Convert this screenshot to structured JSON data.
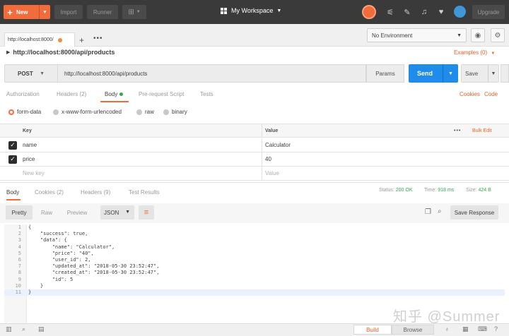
{
  "header": {
    "new_label": "New",
    "import_label": "Import",
    "runner_label": "Runner",
    "workspace_label": "My Workspace",
    "upgrade_label": "Upgrade",
    "icons": [
      "sync-icon",
      "satellite-icon",
      "wrench-icon",
      "bell-icon",
      "heart-icon",
      "avatar"
    ]
  },
  "tabs": [
    {
      "label": "http://localhost:8000/",
      "unsaved": true
    }
  ],
  "environment": {
    "selected": "No Environment"
  },
  "request": {
    "breadcrumb": "http://localhost:8000/api/products",
    "examples_label": "Examples (0)",
    "method": "POST",
    "url": "http://localhost:8000/api/products",
    "params_label": "Params",
    "send_label": "Send",
    "save_label": "Save"
  },
  "request_tabs": {
    "authorization": "Authorization",
    "headers": "Headers (2)",
    "body": "Body",
    "prerequest": "Pre-request Script",
    "tests": "Tests",
    "cookies": "Cookies",
    "code": "Code"
  },
  "body_types": {
    "form_data": "form-data",
    "urlencoded": "x-www-form-urlencoded",
    "raw": "raw",
    "binary": "binary",
    "selected": "form-data"
  },
  "kv_table": {
    "key_header": "Key",
    "value_header": "Value",
    "bulk_edit": "Bulk Edit",
    "rows": [
      {
        "key": "name",
        "value": "Calculator",
        "checked": true
      },
      {
        "key": "price",
        "value": "40",
        "checked": true
      }
    ],
    "new_key_placeholder": "New key",
    "value_placeholder": "Value"
  },
  "response": {
    "tabs": {
      "body": "Body",
      "cookies": "Cookies (2)",
      "headers": "Headers (9)",
      "test_results": "Test Results"
    },
    "status_label": "Status:",
    "status_value": "200 OK",
    "time_label": "Time:",
    "time_value": "918 ms",
    "size_label": "Size:",
    "size_value": "424 B",
    "view_modes": {
      "pretty": "Pretty",
      "raw": "Raw",
      "preview": "Preview"
    },
    "format": "JSON",
    "save_response": "Save Response",
    "code_lines": [
      {
        "n": "1",
        "text": "{"
      },
      {
        "n": "2",
        "text": "    \"success\": true,"
      },
      {
        "n": "3",
        "text": "    \"data\": {"
      },
      {
        "n": "4",
        "text": "        \"name\": \"Calculator\","
      },
      {
        "n": "5",
        "text": "        \"price\": \"40\","
      },
      {
        "n": "6",
        "text": "        \"user_id\": 2,"
      },
      {
        "n": "7",
        "text": "        \"updated_at\": \"2018-05-30 23:52:47\","
      },
      {
        "n": "8",
        "text": "        \"created_at\": \"2018-05-30 23:52:47\","
      },
      {
        "n": "9",
        "text": "        \"id\": 5"
      },
      {
        "n": "10",
        "text": "    }"
      },
      {
        "n": "11",
        "text": "}"
      }
    ]
  },
  "statusbar": {
    "build": "Build",
    "browse": "Browse"
  },
  "watermark": "知乎 @Summer",
  "colors": {
    "accent": "#f26b3a",
    "send": "#1f8ceb",
    "ok": "#2fa84f",
    "topbar": "#3a3a3a"
  }
}
